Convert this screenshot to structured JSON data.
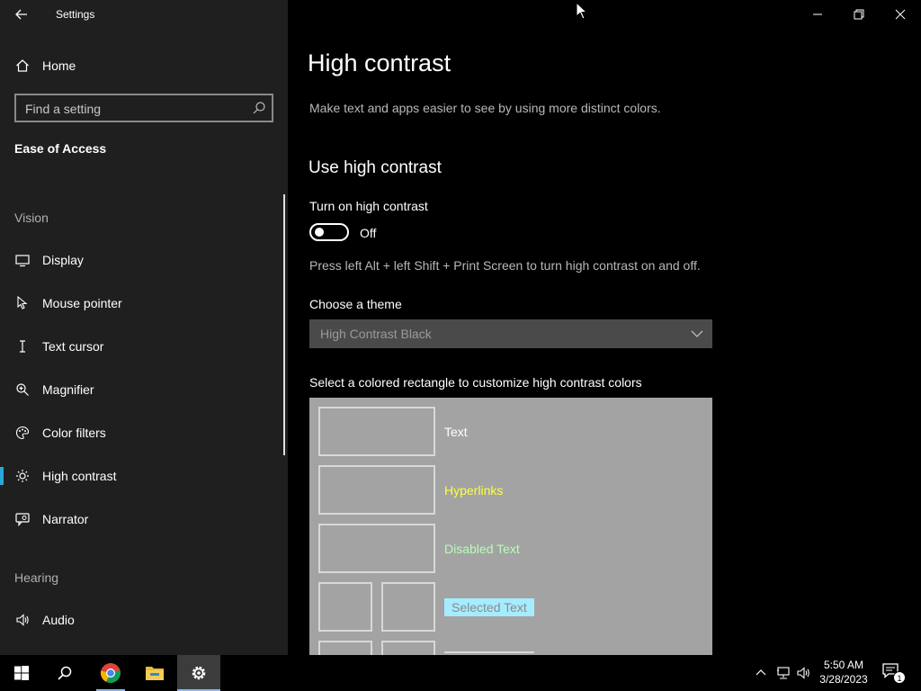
{
  "window": {
    "app_title": "Settings",
    "minimize_icon": "minimize-icon",
    "restore_icon": "restore-icon",
    "close_icon": "close-icon"
  },
  "sidebar": {
    "home_label": "Home",
    "search_placeholder": "Find a setting",
    "section_title": "Ease of Access",
    "groups": {
      "vision": "Vision",
      "hearing": "Hearing"
    },
    "items": [
      {
        "label": "Display",
        "icon": "monitor-icon"
      },
      {
        "label": "Mouse pointer",
        "icon": "mouse-pointer-icon"
      },
      {
        "label": "Text cursor",
        "icon": "text-cursor-icon"
      },
      {
        "label": "Magnifier",
        "icon": "magnifier-icon"
      },
      {
        "label": "Color filters",
        "icon": "palette-icon"
      },
      {
        "label": "High contrast",
        "icon": "brightness-icon",
        "selected": true
      },
      {
        "label": "Narrator",
        "icon": "narrator-icon"
      },
      {
        "label": "Audio",
        "icon": "speaker-icon"
      }
    ],
    "accent_color": "#2aa7d8"
  },
  "main": {
    "title": "High contrast",
    "description": "Make text and apps easier to see by using more distinct colors.",
    "use_heading": "Use high contrast",
    "toggle_label": "Turn on high contrast",
    "toggle_state": "Off",
    "shortcut_hint": "Press left Alt + left Shift + Print Screen to turn high contrast on and off.",
    "theme_label": "Choose a theme",
    "theme_value": "High Contrast Black",
    "colors_label": "Select a colored rectangle to customize high contrast colors",
    "colors": [
      {
        "label": "Text",
        "color": "#ffffff"
      },
      {
        "label": "Hyperlinks",
        "color": "#ffff3c"
      },
      {
        "label": "Disabled Text",
        "color": "#b6ffb6"
      },
      {
        "label": "Selected Text",
        "color": "#a6ecff"
      }
    ]
  },
  "taskbar": {
    "apps": [
      "start-icon",
      "search-icon",
      "chrome-icon",
      "file-explorer-icon",
      "settings-icon"
    ],
    "time": "5:50 AM",
    "date": "3/28/2023",
    "notification_count": "1"
  }
}
